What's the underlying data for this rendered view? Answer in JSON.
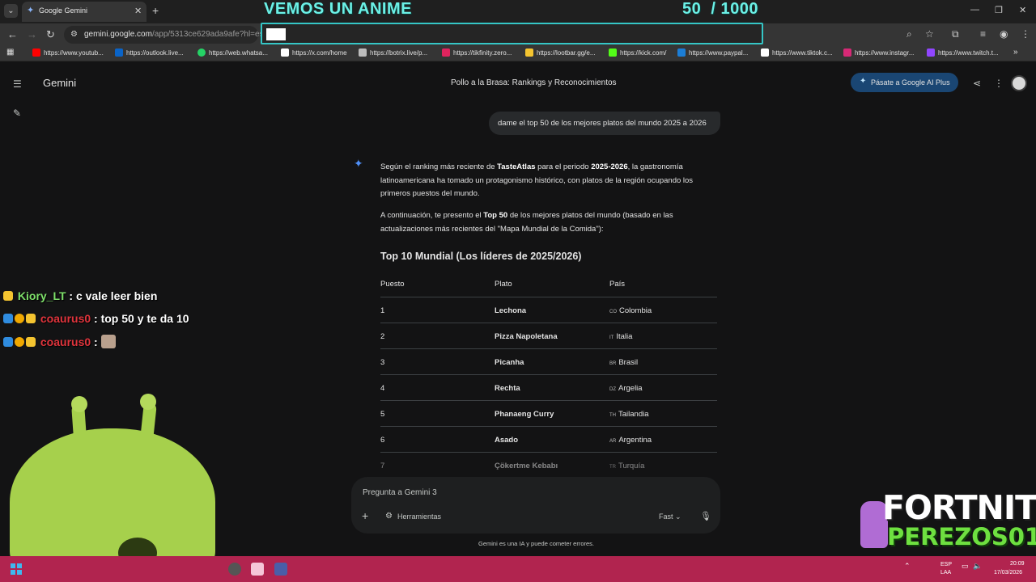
{
  "browser": {
    "tab_title": "Google Gemini",
    "url_host": "gemini.google.com",
    "url_path": "/app/5313ce629ada9afe?hl=es",
    "bookmarks": [
      "https://www.youtub...",
      "https://outlook.live...",
      "https://web.whatsa...",
      "https://x.com/home",
      "https://botrix.live/p...",
      "https://tikfinity.zero...",
      "https://lootbar.gg/e...",
      "https://kick.com/",
      "https://www.paypal...",
      "https://www.tiktok.c...",
      "https://www.instagr...",
      "https://www.twitch.t..."
    ],
    "bookmark_colors": [
      "#ff0000",
      "#0a64c8",
      "#25d366",
      "#ffffff",
      "#bdbdbd",
      "#e0245e",
      "#f4c430",
      "#53fc18",
      "#1c7ed6",
      "#ffffff",
      "#d62976",
      "#9146ff"
    ]
  },
  "overlay": {
    "title": "VEMOS UN ANIME",
    "counter": "50  / 1000",
    "fortnite_line1": "FORTNITE",
    "fortnite_line2": "PEREZOS01"
  },
  "app": {
    "name": "Gemini",
    "conversation_title": "Pollo a la Brasa: Rankings y Reconocimientos",
    "upgrade_button": "Pásate a Google AI Plus",
    "user_prompt": "dame el top 50 de los mejores platos del mundo 2025 a 2026",
    "response": {
      "p1_a": "Según el ranking más reciente de ",
      "p1_b": "TasteAtlas",
      "p1_c": " para el periodo ",
      "p1_d": "2025-2026",
      "p1_e": ", la gastronomía latinoamericana ha tomado un protagonismo histórico, con platos de la región ocupando los primeros puestos del mundo.",
      "p2_a": "A continuación, te presento el ",
      "p2_b": "Top 50",
      "p2_c": " de los mejores platos del mundo (basado en las actualizaciones más recientes del \"Mapa Mundial de la Comida\"):",
      "heading": "Top 10 Mundial (Los líderes de 2025/2026)",
      "table": {
        "headers": [
          "Puesto",
          "Plato",
          "País"
        ],
        "rows": [
          {
            "rank": "1",
            "dish": "Lechona",
            "code": "CO",
            "country": "Colombia"
          },
          {
            "rank": "2",
            "dish": "Pizza Napoletana",
            "code": "IT",
            "country": "Italia"
          },
          {
            "rank": "3",
            "dish": "Picanha",
            "code": "BR",
            "country": "Brasil"
          },
          {
            "rank": "4",
            "dish": "Rechta",
            "code": "DZ",
            "country": "Argelia"
          },
          {
            "rank": "5",
            "dish": "Phanaeng Curry",
            "code": "TH",
            "country": "Tailandia"
          },
          {
            "rank": "6",
            "dish": "Asado",
            "code": "AR",
            "country": "Argentina"
          },
          {
            "rank": "7",
            "dish": "Çökertme Kebabı",
            "code": "TR",
            "country": "Turquía"
          }
        ]
      }
    },
    "input_placeholder": "Pregunta a Gemini 3",
    "tools_label": "Herramientas",
    "mode_label": "Fast",
    "disclaimer": "Gemini es una IA y puede cometer errores."
  },
  "chat": [
    {
      "user": "Kiory_LT",
      "message": " : c vale leer bien"
    },
    {
      "user": "coaurus0",
      "message": " : top 50 y te da 10"
    },
    {
      "user": "coaurus0",
      "message": " : "
    }
  ],
  "taskbar": {
    "lang": "ESP",
    "lang2": "LAA",
    "time": "20:09",
    "date": "17/03/2026"
  }
}
